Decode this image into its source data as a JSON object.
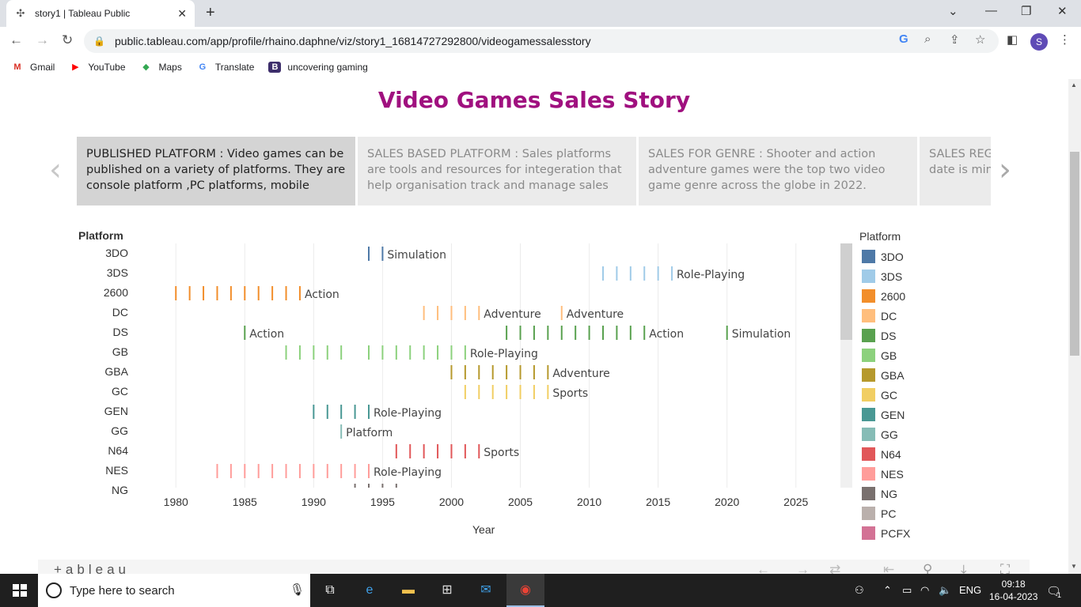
{
  "browser": {
    "tab_title": "story1 | Tableau Public",
    "url": "public.tableau.com/app/profile/rhaino.daphne/viz/story1_16814727292800/videogamessalesstory",
    "avatar_letter": "S",
    "bookmarks": [
      {
        "label": "Gmail",
        "icon": "gmail-icon",
        "glyph": "M",
        "color": "#d93025"
      },
      {
        "label": "YouTube",
        "icon": "youtube-icon",
        "glyph": "▶",
        "color": "#ff0000"
      },
      {
        "label": "Maps",
        "icon": "maps-icon",
        "glyph": "◆",
        "color": "#34a853"
      },
      {
        "label": "Translate",
        "icon": "translate-icon",
        "glyph": "G",
        "color": "#4285f4"
      },
      {
        "label": "uncovering gaming",
        "icon": "bookmark-b-icon",
        "glyph": "B",
        "color": "#3d2e6b"
      }
    ]
  },
  "story": {
    "title": "Video Games Sales Story",
    "points": [
      {
        "text": "PUBLISHED PLATFORM : Video games can be published on a variety of platforms. They are console platform ,PC platforms, mobile",
        "active": true
      },
      {
        "text": "SALES BASED PLATFORM :  Sales platforms are tools and resources for integeration that help organisation track and manage sales",
        "active": false
      },
      {
        "text": "SALES FOR GENRE : Shooter and action adventure games were the top two video game genre across the globe in 2022.",
        "active": false
      },
      {
        "text": "SALES REGION : The best selling game to date is minecraft developed by mojang",
        "active": false
      }
    ]
  },
  "chart_data": {
    "type": "scatter",
    "mark": "tick",
    "title": "",
    "xlabel": "Year",
    "ylabel": "Platform",
    "xlim": [
      1977,
      2028
    ],
    "x_ticks": [
      1980,
      1985,
      1990,
      1995,
      2000,
      2005,
      2010,
      2015,
      2020,
      2025
    ],
    "grid": true,
    "legend_title": "Platform",
    "legend_position": "right",
    "rows": [
      {
        "platform": "3DO",
        "color": "#4e79a7",
        "years": [
          1994,
          1995
        ],
        "labels": [
          {
            "year": 1995,
            "text": "Simulation"
          }
        ]
      },
      {
        "platform": "3DS",
        "color": "#a0cbe8",
        "years": [
          2011,
          2012,
          2013,
          2014,
          2015,
          2016
        ],
        "labels": [
          {
            "year": 2016,
            "text": "Role-Playing"
          }
        ]
      },
      {
        "platform": "2600",
        "color": "#f28e2b",
        "years": [
          1980,
          1981,
          1982,
          1983,
          1984,
          1985,
          1986,
          1987,
          1988,
          1989
        ],
        "labels": [
          {
            "year": 1989,
            "text": "Action"
          }
        ]
      },
      {
        "platform": "DC",
        "color": "#ffbe7d",
        "years": [
          1998,
          1999,
          2000,
          2001,
          2002,
          2008
        ],
        "labels": [
          {
            "year": 2002,
            "text": "Adventure"
          },
          {
            "year": 2008,
            "text": "Adventure"
          }
        ]
      },
      {
        "platform": "DS",
        "color": "#59a14f",
        "years": [
          1985,
          2004,
          2005,
          2006,
          2007,
          2008,
          2009,
          2010,
          2011,
          2012,
          2013,
          2014,
          2020
        ],
        "labels": [
          {
            "year": 1985,
            "text": "Action"
          },
          {
            "year": 2014,
            "text": "Action"
          },
          {
            "year": 2020,
            "text": "Simulation"
          }
        ]
      },
      {
        "platform": "GB",
        "color": "#8cd17d",
        "years": [
          1988,
          1989,
          1990,
          1991,
          1992,
          1994,
          1995,
          1996,
          1997,
          1998,
          1999,
          2000,
          2001
        ],
        "labels": [
          {
            "year": 2001,
            "text": "Role-Playing"
          }
        ]
      },
      {
        "platform": "GBA",
        "color": "#b6992d",
        "years": [
          2000,
          2001,
          2002,
          2003,
          2004,
          2005,
          2006,
          2007
        ],
        "labels": [
          {
            "year": 2007,
            "text": "Adventure"
          }
        ]
      },
      {
        "platform": "GC",
        "color": "#f1ce63",
        "years": [
          2001,
          2002,
          2003,
          2004,
          2005,
          2006,
          2007
        ],
        "labels": [
          {
            "year": 2007,
            "text": "Sports"
          }
        ]
      },
      {
        "platform": "GEN",
        "color": "#499894",
        "years": [
          1990,
          1991,
          1992,
          1993,
          1994
        ],
        "labels": [
          {
            "year": 1994,
            "text": "Role-Playing"
          }
        ]
      },
      {
        "platform": "GG",
        "color": "#86bcb6",
        "years": [
          1992
        ],
        "labels": [
          {
            "year": 1992,
            "text": "Platform"
          }
        ]
      },
      {
        "platform": "N64",
        "color": "#e15759",
        "years": [
          1996,
          1997,
          1998,
          1999,
          2000,
          2001,
          2002
        ],
        "labels": [
          {
            "year": 2002,
            "text": "Sports"
          }
        ]
      },
      {
        "platform": "NES",
        "color": "#ff9d9a",
        "years": [
          1983,
          1984,
          1985,
          1986,
          1987,
          1988,
          1989,
          1990,
          1991,
          1992,
          1993,
          1994
        ],
        "labels": [
          {
            "year": 1994,
            "text": "Role-Playing"
          }
        ]
      },
      {
        "platform": "NG",
        "color": "#79706e",
        "years": [
          1993,
          1994,
          1995,
          1996
        ],
        "labels": []
      }
    ],
    "legend": [
      {
        "name": "3DO",
        "color": "#4e79a7"
      },
      {
        "name": "3DS",
        "color": "#a0cbe8"
      },
      {
        "name": "2600",
        "color": "#f28e2b"
      },
      {
        "name": "DC",
        "color": "#ffbe7d"
      },
      {
        "name": "DS",
        "color": "#59a14f"
      },
      {
        "name": "GB",
        "color": "#8cd17d"
      },
      {
        "name": "GBA",
        "color": "#b6992d"
      },
      {
        "name": "GC",
        "color": "#f1ce63"
      },
      {
        "name": "GEN",
        "color": "#499894"
      },
      {
        "name": "GG",
        "color": "#86bcb6"
      },
      {
        "name": "N64",
        "color": "#e15759"
      },
      {
        "name": "NES",
        "color": "#ff9d9a"
      },
      {
        "name": "NG",
        "color": "#79706e"
      },
      {
        "name": "PC",
        "color": "#bab0ac"
      },
      {
        "name": "PCFX",
        "color": "#d37295"
      }
    ]
  },
  "tableau": {
    "logo_text": "+ableau"
  },
  "taskbar": {
    "search_placeholder": "Type here to search",
    "language": "ENG",
    "time": "09:18",
    "date": "16-04-2023",
    "notification_count": "1"
  }
}
